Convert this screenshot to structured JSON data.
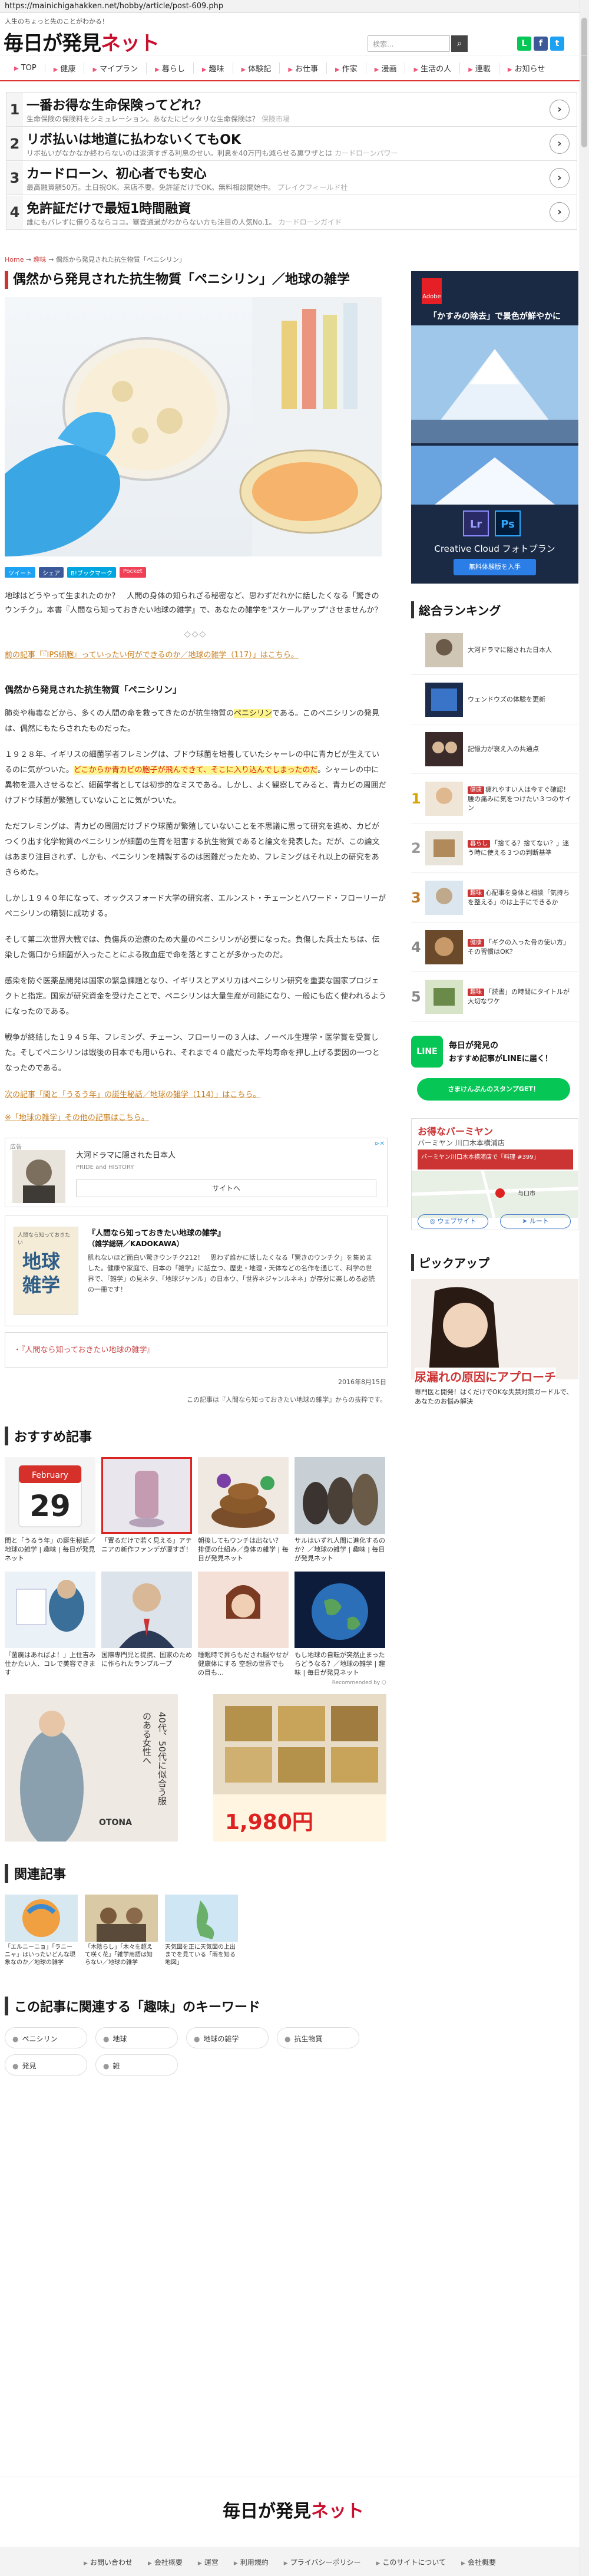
{
  "browser": {
    "url": "https://mainichigahakken.net/hobby/article/post-609.php"
  },
  "header": {
    "tagline": "人生のちょっと先のことがわかる！",
    "logo_main": "毎日が発見",
    "logo_accent": "ネット",
    "search_placeholder": "検索...",
    "search_icon": "search-icon",
    "social_icons": [
      "line-icon",
      "facebook-icon",
      "twitter-icon"
    ]
  },
  "nav": {
    "items": [
      "TOP",
      "健康",
      "マイプラン",
      "暮らし",
      "趣味",
      "体験記",
      "お仕事",
      "作家",
      "漫画",
      "生活の人",
      "連載",
      "お知らせ"
    ]
  },
  "ad_strip": {
    "rows": [
      {
        "num": "1",
        "title": "一番お得な生命保険ってどれ？",
        "sub": "生命保険の保険料をシミュレーション。あなたにピッタリな生命保険は？",
        "adv": "保険市場"
      },
      {
        "num": "2",
        "title": "リボ払いは地道に払わないくてもOK",
        "sub": "リボ払いがなかなか終わらないのは返済すぎる利息のせい。利息を40万円も減らせる裏ワザとは",
        "adv": "カードローンパワー"
      },
      {
        "num": "3",
        "title": "カードローン、初心者でも安心",
        "sub": "最高融資額50万。土日祝OK。来店不要。免許証だけでOK。無料相談開始中。",
        "adv": "プレイクフィールド社"
      },
      {
        "num": "4",
        "title": "免許証だけで最短1時間融資",
        "sub": "誰にもバレずに借りるならココ。審査通過がわからない方も注目の人気No.1。",
        "adv": "カードローンガイド"
      }
    ]
  },
  "breadcrumb": {
    "home": "Home",
    "cat": "趣味",
    "current": "偶然から発見された抗生物質「ペニシリン」"
  },
  "article": {
    "title": "偶然から発見された抗生物質「ペニシリン」／地球の雑学",
    "share": [
      {
        "label": "ツイート",
        "color": "#1da1f2"
      },
      {
        "label": "シェア",
        "color": "#3b5998"
      },
      {
        "label": "B!ブックマーク",
        "color": "#00a4de"
      },
      {
        "label": "Pocket",
        "color": "#ef4056"
      }
    ],
    "lead": "地球はどうやって生まれたのか？　人間の身体の知られざる秘密など、思わずだれかに話したくなる「驚きのウンチク」。本書『人間なら知っておきたい地球の雑学』で、あなたの雑学を\"スケールアップ\"させませんか？",
    "diamonds": "◇◇◇",
    "prev_link": "前の記事「『IPS細胞』っていったい何ができるのか／地球の雑学（117）」はこちら。",
    "section_title": "偶然から発見された抗生物質「ペニシリン」",
    "para1_a": "肺炎や梅毒などから、多くの人間の命を救ってきたのが抗生物質の",
    "para1_hl": "ペニシリン",
    "para1_b": "である。このペニシリンの発見は、偶然にもたらされたものだった。",
    "para2_a": "１９２８年、イギリスの細菌学者フレミングは、ブドウ球菌を培養していたシャーレの中に青カビが生えているのに気がついた。",
    "para2_hl": "どこからか青カビの胞子が飛んできて、そこに入り込んでしまったのだ",
    "para2_b": "。シャーレの中に異物を混入させるなど、細菌学者としては初歩的なミスである。しかし、よく観察してみると、青カビの周囲だけブドウ球菌が繁殖していないことに気がついた。",
    "para3": "ただフレミングは、青カビの周囲だけブドウ球菌が繁殖していないことを不思議に思って研究を進め、カビがつくり出す化学物質のペニシリンが細菌の生育を阻害する抗生物質であると論文を発表した。だが、この論文はあまり注目されず、しかも、ペニシリンを精製するのは困難だったため、フレミングはそれ以上の研究をあきらめた。",
    "para4": "しかし１９４０年になって、オックスフォード大学の研究者、エルンスト・チェーンとハワード・フローリーがペニシリンの精製に成功する。",
    "para5": "そして第二次世界大戦では、負傷兵の治療のため大量のペニシリンが必要になった。負傷した兵士たちは、伝染した傷口から細菌が入ったことによる敗血症で命を落とすことが多かったのだ。",
    "para6": "感染を防ぐ医薬品開発は国家の緊急課題となり、イギリスとアメリカはペニシリン研究を重要な国家プロジェクトと指定。国家が研究資金を受けたことで、ペニシリンは大量生産が可能になり、一般にも広く使われるようになったのである。",
    "para7": "戦争が終結した１９４５年、フレミング、チェーン、フローリーの３人は、ノーベル生理学・医学賞を受賞した。そしてペニシリンは戦後の日本でも用いられ、それまで４０歳だった平均寿命を押し上げる要因の一つとなったのである。",
    "next_link": "次の記事「閏と「うるう年」の誕生秘話／地球の雑学（114）」はこちら。",
    "more_link": "※「地球の雑学」その他の記事はこちら。",
    "date": "2016年8月15日",
    "source": "この記事は『人間なら知っておきたい地球の雑学』からの抜粋です。"
  },
  "ad_box": {
    "label": "広告",
    "title": "大河ドラマに隠された日本人",
    "sub": "PRIDE and HISTORY",
    "cta": "サイトへ"
  },
  "book_box": {
    "cover_line1": "地球",
    "cover_line2": "雑学",
    "cover_top": "人間なら知っておきたい",
    "title": "『人間なら知っておきたい地球の雑学』",
    "publisher": "（雑学総研／KADOKAWA）",
    "desc": "肌れないほど面白い驚きウンチク212！　思わず誰かに話したくなる「驚きのウンチク」を集めました。健康や家庭で、日本の「雑学」に話立つ、歴史・地理・天体などの名作を通じて、科学の世界で、「雑学」の見ネタ、「地球ジャンル」の日本ウ、「世界ネジャンルネネ」が存分に楽しめる必読の一冊です！",
    "link": "・『人間なら知っておきたい地球の雑学』"
  },
  "recommend": {
    "title": "おすすめ記事",
    "items": [
      {
        "cap": "閏と「うるう年」の誕生秘話／地球の雑学 | 趣味 | 毎日が発見ネット",
        "by": "",
        "img_kind": "calendar"
      },
      {
        "cap": "「置るだけで若く見える」アテニアの新作ファンデが凄すぎ！",
        "by": "",
        "img_kind": "cosmetic"
      },
      {
        "cap": "朝後してもウンチは出ない？ 排便の仕組み／身体の雑学 | 毎日が発見ネット",
        "by": "",
        "img_kind": "poop"
      },
      {
        "cap": "サルはいずれ人間に進化するのか？／地球の雑学 | 趣味 | 毎日が発見ネット",
        "by": "",
        "img_kind": "monkey"
      },
      {
        "cap": "「菌廣はあればよ！」上住吉み仕かたい人、コレで美容できます",
        "by": "",
        "img_kind": "stock"
      },
      {
        "cap": "国際専門児と提携、国家のために作られたランプループ",
        "by": "",
        "img_kind": "man"
      },
      {
        "cap": "睡眠時で昇らもだされ脳やせが健康体にする 空想の世界でもの目も…",
        "by": "",
        "img_kind": "woman"
      },
      {
        "cap": "もし地球の自転が突然止まったらどうなる？／地球の雑学 | 趣味 | 毎日が発見ネット",
        "by": "",
        "img_kind": "earth"
      }
    ],
    "recommended_by": "Recommended by"
  },
  "banners": {
    "left_title": "40代、50代に似合う服のある女性へ",
    "left_brand": "OTONA",
    "right_price": "1,980円"
  },
  "related": {
    "title": "関連記事",
    "items": [
      {
        "cap": "「エルニーニョ」「ラニーニャ」はいったいどんな現象なのか／地球の雑学"
      },
      {
        "cap": "「木陰らし」「木々を超えて咲く花」「雑学用語は知らない／地球の雑学"
      },
      {
        "cap": "天気図を正に天気図の上出までを見ている「雨を知る地図」"
      }
    ]
  },
  "keywords": {
    "title": "この記事に関連する「趣味」のキーワード",
    "items": [
      "ペニシリン",
      "地球",
      "地球の雑学",
      "抗生物質",
      "発見",
      "雑"
    ]
  },
  "footer": {
    "logo_main": "毎日が発見",
    "logo_accent": "ネット",
    "links": [
      "お問い合わせ",
      "会社概要",
      "運営",
      "利用規約",
      "プライバシーポリシー",
      "このサイトについて",
      "会社概要"
    ]
  },
  "sidebar": {
    "ad1_brand": "Adobe",
    "ad1_headline": "「かすみの除去」で景色が鮮やかに",
    "ad1_product": "Creative Cloud フォトプラン",
    "ad1_cta": "無料体験版を入手",
    "ranking_title": "総合ランキング",
    "ranking": [
      {
        "num": "",
        "text": "大河ドラマに隠された日本人",
        "tag": ""
      },
      {
        "num": "",
        "text": "ウェンドウズの体験を更新",
        "tag": ""
      },
      {
        "num": "",
        "text": "記憶力が衰え入の共通点",
        "tag": ""
      },
      {
        "num": "1",
        "text": "疲れやすい人は今すぐ確認！腰の痛みに気をつけたい３つのサイン",
        "tag": "健康"
      },
      {
        "num": "2",
        "text": "「捨てる？捨てない？」迷う時に使える３つの判断基準",
        "tag": "暮らし"
      },
      {
        "num": "3",
        "text": "心配事を身体と相談「気持ちを整える」のは上手にできるか",
        "tag": "趣味"
      },
      {
        "num": "4",
        "text": "「ギクの入った骨の使い方」その習慣はOK？",
        "tag": "健康"
      },
      {
        "num": "5",
        "text": "「読書」の時間にタイトルが大切なワケ",
        "tag": "趣味"
      }
    ],
    "line_title": "毎日が発見の",
    "line_title2": "おすすめ記事がLINEに届く！",
    "line_cta": "さまけんぷんのスタンプGET！",
    "map_title": "お得なバーミヤン",
    "map_sub": "バーミヤン 川口木本横浦店",
    "map_detail": "バーミヤン川口木本横浦店で「料理 #399」",
    "map_address": "与口市",
    "map_btn1": "ウェブサイト",
    "map_btn2": "ルート",
    "pickup_title": "ピックアップ",
    "pickup_headline": "尿漏れの原因にアプローチ",
    "pickup_desc": "専門医と開発！はくだけでOKな失禁対策ガードルで、あなたのお悩み解決"
  }
}
